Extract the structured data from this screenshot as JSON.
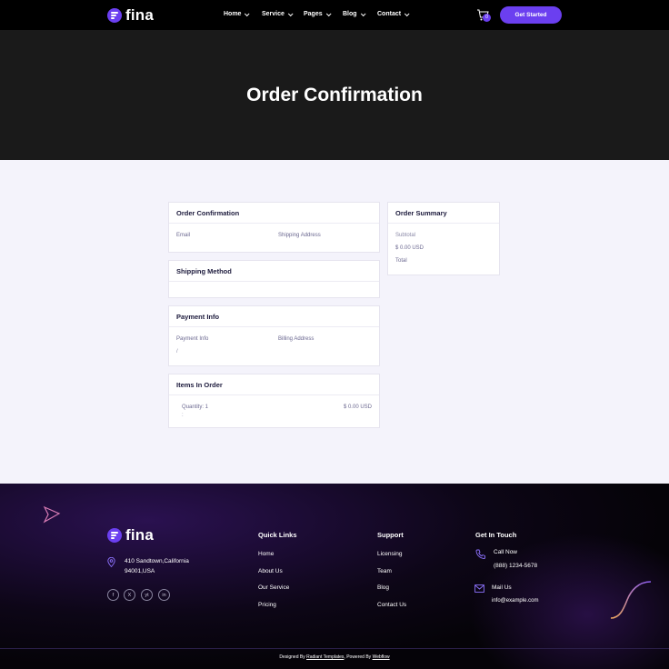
{
  "brand": {
    "name": "fina"
  },
  "nav": {
    "items": [
      "Home",
      "Service",
      "Pages",
      "Blog",
      "Contact"
    ],
    "cart_count": "0",
    "cta": "Get Started"
  },
  "hero": {
    "title": "Order Confirmation"
  },
  "order_confirmation": {
    "title": "Order Confirmation",
    "email_label": "Email",
    "shipping_label": "Shipping Address"
  },
  "shipping_method": {
    "title": "Shipping Method"
  },
  "payment_info": {
    "title": "Payment Info",
    "payment_label": "Payment Info",
    "billing_label": "Billing Address",
    "payment_value": "/"
  },
  "items_in_order": {
    "title": "Items In Order",
    "quantity": "Quantity: 1",
    "price": "$ 0.00 USD",
    "extra": ":"
  },
  "order_summary": {
    "title": "Order Summary",
    "subtotal_label": "Subtotal",
    "subtotal_value": "$ 0.00 USD",
    "total_label": "Total"
  },
  "footer": {
    "address_line1": "410 Sandtown,California",
    "address_line2": "94001,USA",
    "socials": [
      "f",
      "X",
      "yt",
      "in"
    ],
    "quick_links": {
      "title": "Quick Links",
      "items": [
        "Home",
        "About Us",
        "Our Service",
        "Pricing"
      ]
    },
    "support": {
      "title": "Support",
      "items": [
        "Licensing",
        "Team",
        "Blog",
        "Contact Us"
      ]
    },
    "contact": {
      "title": "Get In Touch",
      "call_label": "Call Now",
      "phone": "(888) 1234-5678",
      "mail_label": "Mail Us",
      "email": "info@example.com"
    },
    "credit_prefix": "Designed By ",
    "credit_designer": "Radiant Templates",
    "credit_mid": ", Powered By ",
    "credit_platform": "Webflow"
  },
  "colors": {
    "accent": "#6b3ff0",
    "hero_bg": "#1a1a1a",
    "page_bg": "#f4f3fb"
  }
}
